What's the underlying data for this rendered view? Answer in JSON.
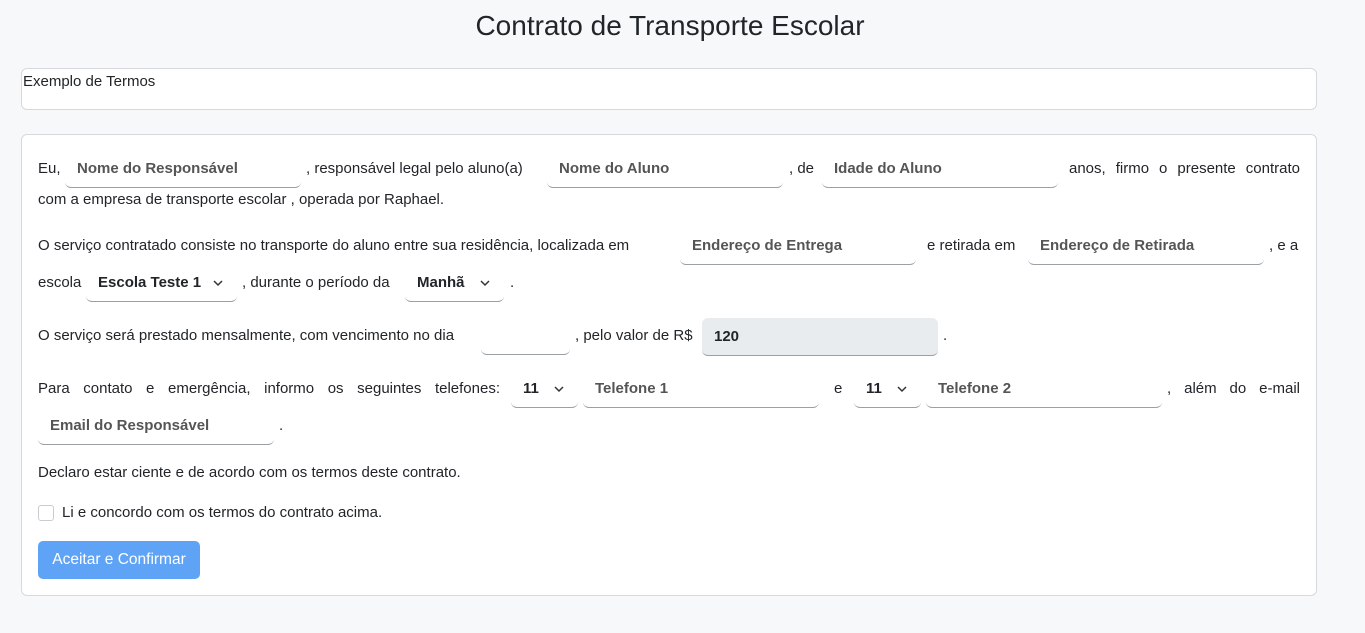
{
  "header": {
    "title": "Contrato de Transporte Escolar"
  },
  "terms_box": {
    "text": "Exemplo de Termos"
  },
  "contract": {
    "p1": {
      "t1": "Eu,",
      "responsavel_placeholder": "Nome do Responsável",
      "t2": ", responsável legal pelo aluno(a)",
      "aluno_placeholder": "Nome do Aluno",
      "t3": ", de",
      "idade_placeholder": "Idade do Aluno",
      "t4": "anos, firmo o presente contrato",
      "t5": "com a empresa de transporte escolar , operada por Raphael."
    },
    "p2": {
      "t1": "O serviço contratado consiste no transporte do aluno entre sua residência, localizada em",
      "entrega_placeholder": "Endereço de Entrega",
      "t2": "e retirada em",
      "retirada_placeholder": "Endereço de Retirada",
      "t3": ", e a",
      "t4": "escola",
      "escola_value": "Escola Teste 1",
      "t5": ", durante o período da",
      "periodo_value": "Manhã",
      "t6": "."
    },
    "p3": {
      "t1": "O serviço será prestado mensalmente, com vencimento no dia",
      "dia_value": "",
      "t2": ", pelo valor de R$",
      "valor_value": "120",
      "t3": "."
    },
    "p4": {
      "t1": "Para contato e emergência, informo os seguintes telefones:",
      "ddd1_value": "11",
      "telefone1_placeholder": "Telefone 1",
      "t2": "e",
      "ddd2_value": "11",
      "telefone2_placeholder": "Telefone 2",
      "t3": ", além do e-mail",
      "email_placeholder": "Email do Responsável",
      "t4": "."
    },
    "declaration": "Declaro estar ciente e de acordo com os termos deste contrato.",
    "checkbox_label": "Li e concordo com os termos do contrato acima.",
    "checkbox_checked": false,
    "submit_label": "Aceitar e Confirmar"
  },
  "colors": {
    "button_bg": "#5fa3f7",
    "page_bg": "#f7f8fa",
    "readonly_bg": "#e9ecef"
  }
}
